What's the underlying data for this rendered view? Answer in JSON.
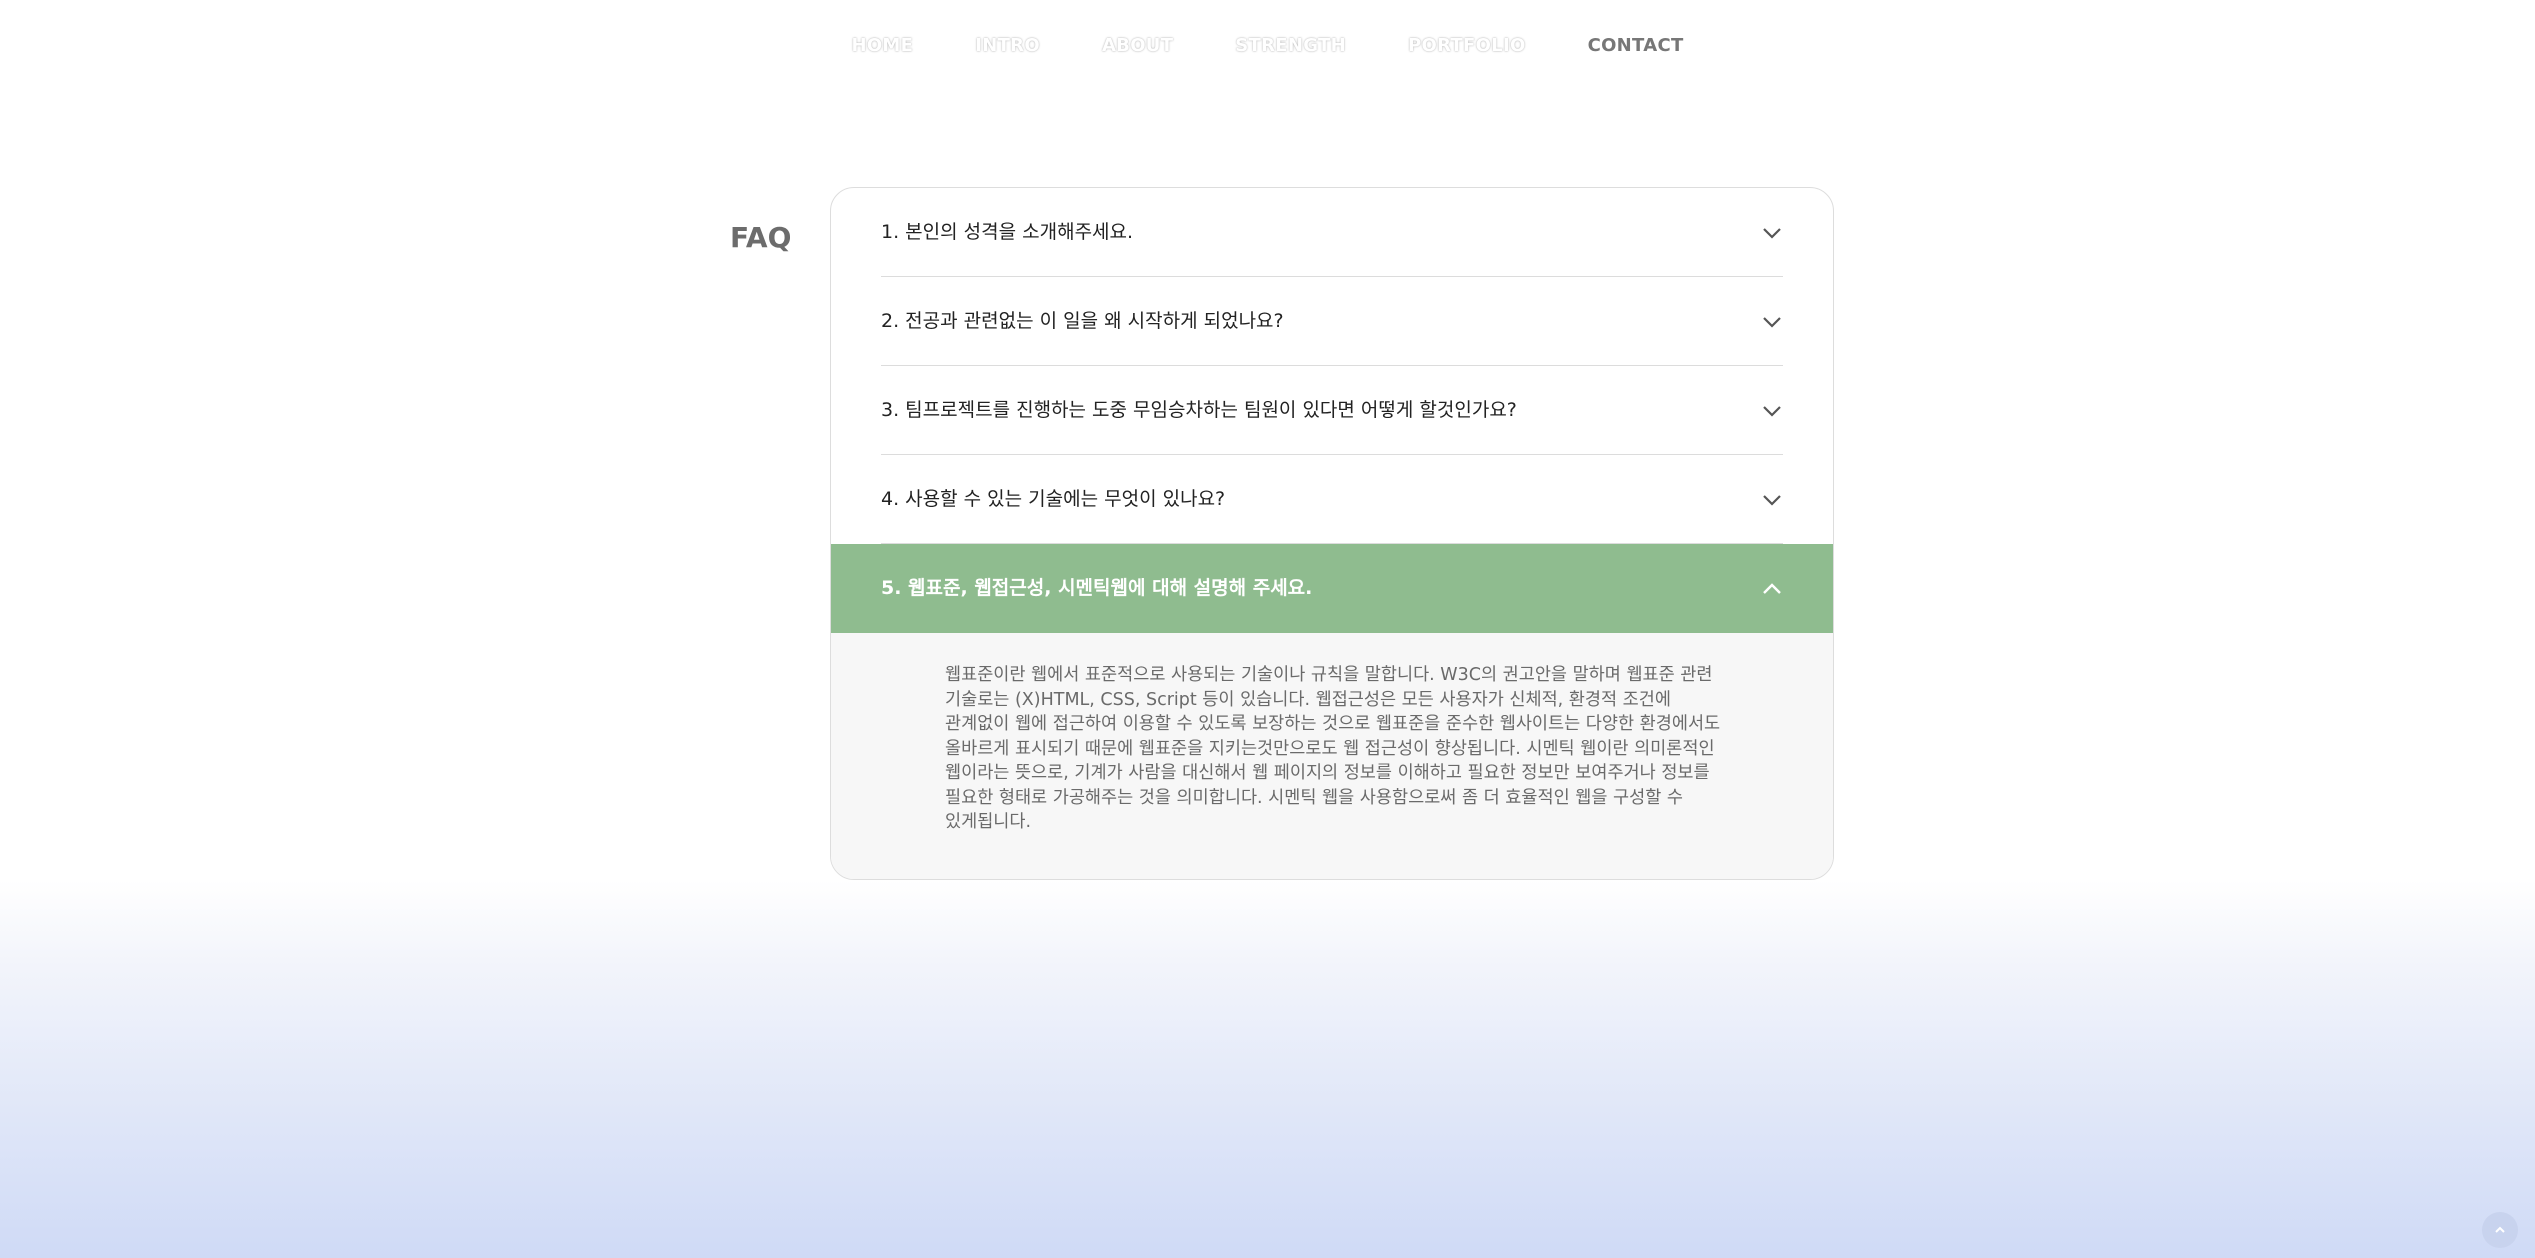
{
  "nav": {
    "items": [
      "HOME",
      "INTRO",
      "ABOUT",
      "STRENGTH",
      "PORTFOLIO",
      "CONTACT"
    ],
    "active": "CONTACT"
  },
  "faq": {
    "title": "FAQ",
    "questions": [
      "1. 본인의 성격을 소개해주세요.",
      "2. 전공과 관련없는 이 일을 왜 시작하게 되었나요?",
      "3. 팀프로젝트를 진행하는 도중 무임승차하는 팀원이 있다면 어떻게 할것인가요?",
      "4. 사용할 수 있는 기술에는 무엇이 있나요?",
      "5. 웹표준, 웹접근성, 시멘틱웹에 대해 설명해 주세요."
    ],
    "open_index": 4,
    "answer": "웹표준이란 웹에서 표준적으로 사용되는 기술이나 규칙을 말합니다. W3C의 권고안을 말하며 웹표준 관련 기술로는 (X)HTML, CSS, Script 등이 있습니다. 웹접근성은 모든 사용자가 신체적, 환경적 조건에 관계없이 웹에 접근하여 이용할 수 있도록 보장하는 것으로 웹표준을 준수한 웹사이트는 다양한 환경에서도 올바르게 표시되기 때문에 웹표준을 지키는것만으로도 웹 접근성이 향상됩니다. 시멘틱 웹이란 의미론적인 웹이라는 뜻으로, 기계가 사람을 대신해서 웹 페이지의 정보를 이해하고 필요한 정보만 보여주거나 정보를 필요한 형태로 가공해주는 것을 의미합니다. 시멘틱 웹을 사용함으로써 좀 더 효율적인 웹을 구성할 수 있게됩니다."
  },
  "icons": {
    "chevron_closed": "chevron-down-icon",
    "chevron_open": "chevron-up-icon",
    "top_button": "arrow-up-icon"
  },
  "colors": {
    "accent": "#8fbc8f",
    "nav_active": "#777777",
    "answer_bg": "#f7f7f7"
  }
}
